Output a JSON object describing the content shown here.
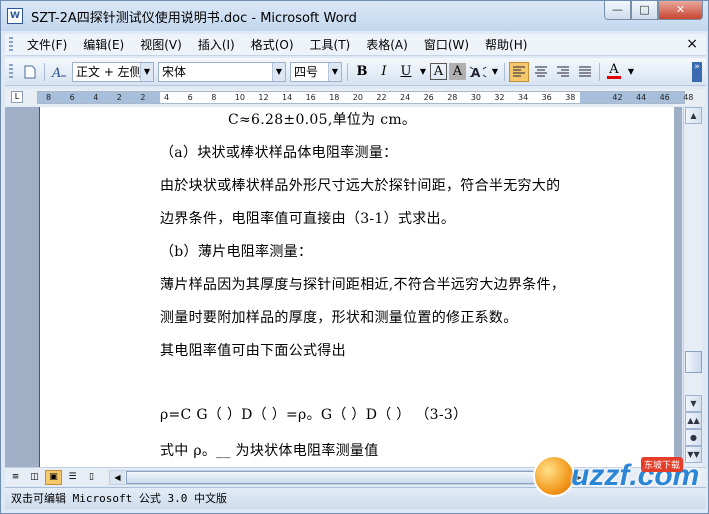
{
  "window": {
    "app_icon": "W",
    "title": "SZT-2A四探针测试仪使用说明书.doc - Microsoft Word",
    "controls": [
      "—",
      "□",
      "✕"
    ]
  },
  "menu": {
    "items": [
      "文件(F)",
      "编辑(E)",
      "视图(V)",
      "插入(I)",
      "格式(O)",
      "工具(T)",
      "表格(A)",
      "窗口(W)",
      "帮助(H)"
    ],
    "close": "×"
  },
  "toolbar": {
    "style_value": "正文 + 左侧",
    "font_value": "宋体",
    "size_value": "四号",
    "bold": "B",
    "italic": "I",
    "underline": "U",
    "border_a": "A",
    "shade_a": "A",
    "font_color_a": "A",
    "font_color": "#e00000"
  },
  "ruler": {
    "ticks": [
      "8",
      "6",
      "4",
      "2",
      "2",
      "4",
      "6",
      "8",
      "10",
      "12",
      "14",
      "16",
      "18",
      "20",
      "22",
      "24",
      "26",
      "28",
      "30",
      "32",
      "34",
      "36",
      "38",
      "42",
      "44",
      "46",
      "48"
    ]
  },
  "document": {
    "lines": [
      "C≈6.28±0.05,单位为 cm。",
      "（a）块状或棒状样品体电阻率测量：",
      "由於块状或棒状样品外形尺寸远大於探针间距，符合半无穷大的",
      "边界条件，电阻率值可直接由（3-1）式求出。",
      "（b）薄片电阻率测量：",
      "薄片样品因为其厚度与探针间距相近,不符合半远穷大边界条件，",
      "测量时要附加样品的厚度，形状和测量位置的修正系数。",
      " 其电阻率值可由下面公式得出",
      "ρ=C    G（   ）D（  ）=ρ。G（   ）D（  ）     （3-3）",
      "式中 ρ。__  为块状体电阻率测量值"
    ]
  },
  "status": {
    "text": "双击可编辑 Microsoft 公式 3.0 中文版"
  },
  "watermark": {
    "text": "uzzf.com",
    "tag": "东坡下载"
  }
}
